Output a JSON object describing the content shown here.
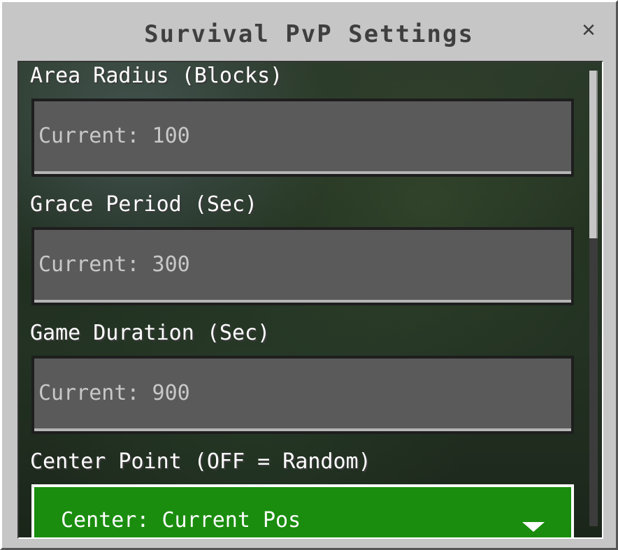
{
  "dialog": {
    "title": "Survival PvP Settings",
    "close_glyph": "✕"
  },
  "form": {
    "area_radius": {
      "label": "Area Radius (Blocks)",
      "placeholder": "Current: 100"
    },
    "grace_period": {
      "label": "Grace Period (Sec)",
      "placeholder": "Current: 300"
    },
    "game_duration": {
      "label": "Game Duration (Sec)",
      "placeholder": "Current: 900"
    },
    "center_point": {
      "label": "Center Point (OFF = Random)",
      "selected": "Center: Current Pos"
    }
  },
  "colors": {
    "panel": "#c6c6c6",
    "field": "#5a5a5a",
    "dropdown": "#1a8d0e",
    "title_text": "#3f3f3f"
  },
  "icons": {
    "close": "close-icon",
    "dropdown": "chevron-down-icon"
  }
}
